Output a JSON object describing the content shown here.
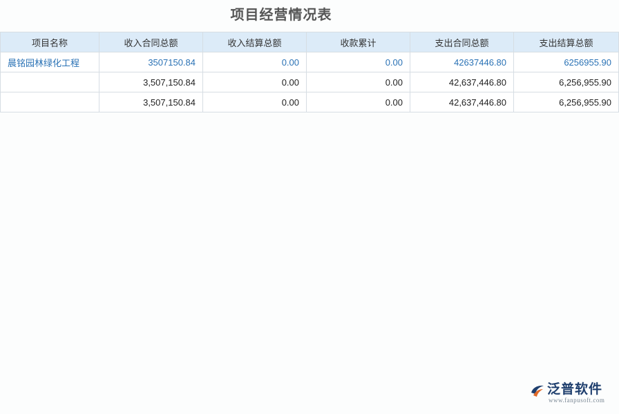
{
  "page": {
    "title": "项目经营情况表"
  },
  "table": {
    "headers": [
      "项目名称",
      "收入合同总额",
      "收入结算总额",
      "收款累计",
      "支出合同总额",
      "支出结算总额"
    ],
    "rows": [
      [
        "晨铭园林绿化工程",
        "3507150.84",
        "0.00",
        "0.00",
        "42637446.80",
        "6256955.90"
      ],
      [
        "",
        "3,507,150.84",
        "0.00",
        "0.00",
        "42,637,446.80",
        "6,256,955.90"
      ],
      [
        "",
        "3,507,150.84",
        "0.00",
        "0.00",
        "42,637,446.80",
        "6,256,955.90"
      ]
    ]
  },
  "brand": {
    "name": "泛普软件",
    "url": "www.fanpusoft.com",
    "colors": {
      "primary": "#1f3f6e",
      "accent": "#e06a2a",
      "link": "#2a72b5",
      "header_bg": "#dcebf8"
    }
  }
}
